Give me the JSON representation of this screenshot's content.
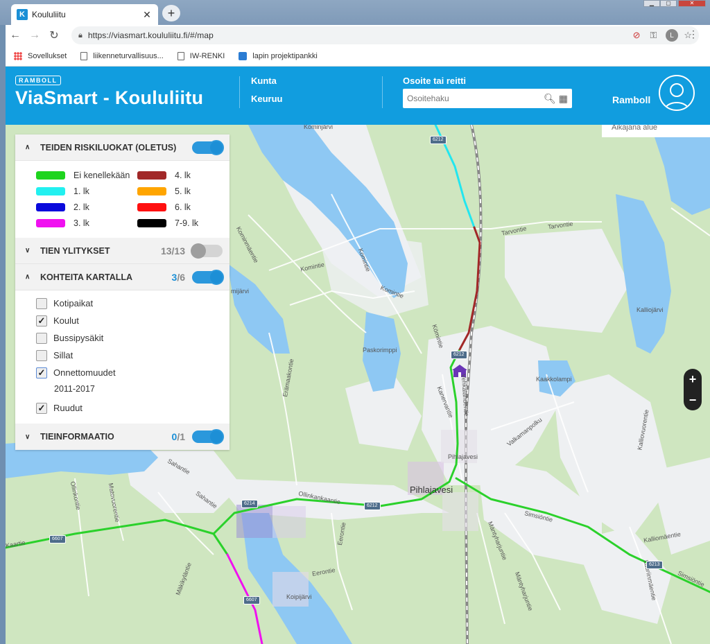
{
  "browser": {
    "tab_title": "Koululiitu",
    "tab_favicon": "K",
    "url": "https://viasmart.koululiitu.fi/#/map",
    "profile_initial": "L",
    "bookmarks": [
      {
        "label": "Sovellukset",
        "icon": "apps-grid-icon"
      },
      {
        "label": "liikenneturvallisuus...",
        "icon": "page-icon"
      },
      {
        "label": "IW-RENKI",
        "icon": "page-icon"
      },
      {
        "label": "lapin projektipankki",
        "icon": "bookmark-favicon-icon"
      }
    ]
  },
  "header": {
    "badge": "RAMBOLL",
    "title": "ViaSmart - Koululiitu",
    "municipality_label": "Kunta",
    "municipality_value": "Keuruu",
    "address_label": "Osoite tai reitti",
    "address_placeholder": "Osoitehaku",
    "brand": "Ramboll"
  },
  "panel": {
    "risk_section": {
      "title": "TEIDEN RISKILUOKAT (OLETUS)",
      "expanded": true,
      "toggle_on": true,
      "legend": [
        {
          "label": "Ei kenellekään",
          "color": "#1ed41e"
        },
        {
          "label": "4. lk",
          "color": "#a12828"
        },
        {
          "label": "1. lk",
          "color": "#22f0f0"
        },
        {
          "label": "5. lk",
          "color": "#ffa500"
        },
        {
          "label": "2. lk",
          "color": "#0a0adc"
        },
        {
          "label": "6. lk",
          "color": "#ff1010"
        },
        {
          "label": "3. lk",
          "color": "#f010f0"
        },
        {
          "label": "7-9. lk",
          "color": "#000000"
        }
      ]
    },
    "crossings_section": {
      "title": "TIEN YLITYKSET",
      "count": "13/13",
      "toggle_on": false
    },
    "targets_section": {
      "title": "KOHTEITA KARTALLA",
      "count_num": "3",
      "count_total": "/6",
      "toggle_on": true,
      "items": [
        {
          "label": "Kotipaikat",
          "checked": false
        },
        {
          "label": "Koulut",
          "checked": true
        },
        {
          "label": "Bussipysäkit",
          "checked": false
        },
        {
          "label": "Sillat",
          "checked": false
        },
        {
          "label": "Onnettomuudet",
          "checked": true,
          "sublabel": "2011-2017"
        },
        {
          "label": "Ruudut",
          "checked": true
        }
      ]
    },
    "info_section": {
      "title": "TIEINFORMAATIO",
      "count_num": "0",
      "count_total": "/1",
      "toggle_on": true
    }
  },
  "map": {
    "info_strip": "Aikajana alue",
    "labels": {
      "kominjarvi": "Kominjärvi",
      "tarvontie1": "Tarvontie",
      "tarvontie2": "Tarvontie",
      "kominmaentie": "Kominmäentie",
      "komintie1": "Komintie",
      "komintie2": "Komintie",
      "komintie3": "Komintie",
      "komintie4": "Kömintie",
      "paskorimppi": "Paskorimppi",
      "kalliojarvi": "Kalliojärvi",
      "kaakkolampi": "Kaakkolampi",
      "kanervantie": "Kanervantie",
      "erämaakontie": "Erämaakontie",
      "valkamanpolku": "Valkamanpolku",
      "kallioviertie": "Kalliovuorentie",
      "pihlajavesi_small": "Pihlajavesi",
      "pihlajavesi_big": "Pihlajavesi",
      "vehkantie": "Vehkalahdentie",
      "sahantie1": "Sahantie",
      "sahantie2": "Sahantie",
      "ollinkankaantie": "Ollinkankaantie",
      "simsiontie1": "Simsiöntie",
      "simsiontie2": "Simsiöntie",
      "kalliomaentie": "Kalliomäentie",
      "mantyharjuntie1": "Mäntyharjuntie",
      "mantyharjuntie2": "Mäntyharjuntie",
      "lauriinmaentie": "Lauriinmäentie",
      "eerontie1": "Eerontie",
      "eerontie2": "Eerontie",
      "koipijarvi": "Koipijärvi",
      "mattivuorentie": "Matovuorentie",
      "ollinkontie": "Ollinkontie",
      "makikyläntie": "Mäkikyläntie",
      "mijarvi": "mijärvi",
      "kaartie": "Kaartie"
    },
    "shields": {
      "s1": "6212",
      "s2": "6212",
      "s3": "6214",
      "s4": "6212",
      "s5": "6607",
      "s6": "6607",
      "s7": "6213"
    },
    "zoom_in": "+",
    "zoom_out": "−"
  }
}
